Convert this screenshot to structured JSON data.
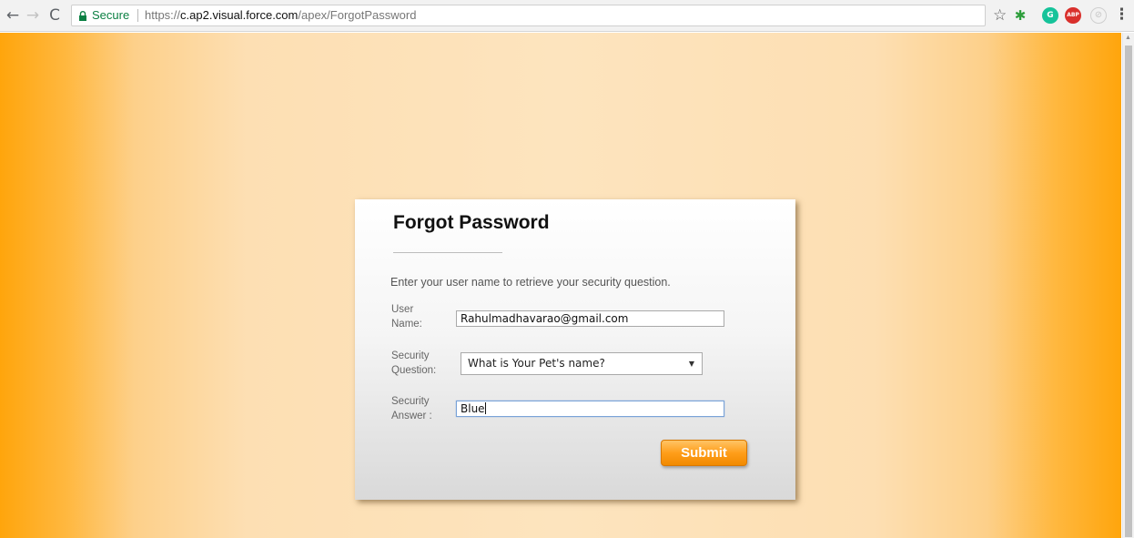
{
  "browser": {
    "secure_label": "Secure",
    "url_prefix": "https://",
    "url_host": "c.ap2.visual.force.com",
    "url_path": "/apex/ForgotPassword",
    "extensions": [
      {
        "name": "bug-extension-icon",
        "color": "#2e9e3c",
        "glyph": ""
      },
      {
        "name": "grammarly-icon",
        "color": "#15c39a",
        "glyph": "G"
      },
      {
        "name": "adblock-icon",
        "color": "#d9302c",
        "glyph": "ABP"
      },
      {
        "name": "disabled-extension-icon",
        "color": "#cfcfcf",
        "glyph": ""
      }
    ]
  },
  "form": {
    "title": "Forgot Password",
    "instructions": "Enter your user name to retrieve your security question.",
    "username": {
      "label_line1": "User",
      "label_line2": "Name:",
      "value": "Rahulmadhavarao@gmail.com"
    },
    "security_question": {
      "label_line1": "Security",
      "label_line2": "Question:",
      "selected": "What is Your Pet's name?"
    },
    "security_answer": {
      "label_line1": "Security",
      "label_line2": "Answer :",
      "value": "Blue"
    },
    "submit_label": "Submit"
  },
  "colors": {
    "accent_orange": "#ff9e1a",
    "secure_green": "#0b8043"
  }
}
